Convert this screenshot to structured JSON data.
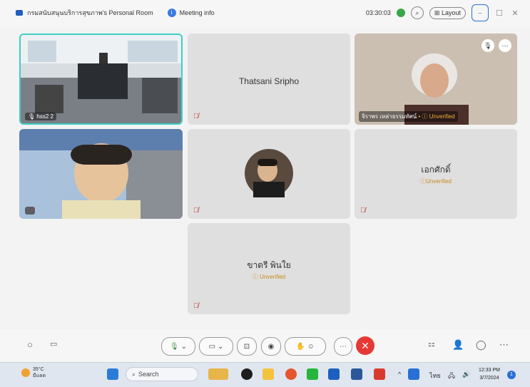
{
  "titlebar": {
    "room_name": "กรมสนับสนุนบริการสุขภาพ's Personal Room",
    "meeting_info_label": "Meeting info",
    "timer": "03:30:03",
    "layout_label": "Layout",
    "minimize_label": "–",
    "restore_label": "☐",
    "close_label": "✕"
  },
  "participants": {
    "p1": {
      "name": "hss2 2"
    },
    "p2": {
      "name": "Thatsani Sripho"
    },
    "p3": {
      "name": "จิราพร เหล่าธรรมทัศน์",
      "status": "Unverified"
    },
    "p4": {
      "name": ""
    },
    "p5": {
      "name": ""
    },
    "p6": {
      "name": "เอกศักดิ์",
      "status": "Unverified"
    },
    "p7": {
      "name": "ขาตรี พินใย",
      "status": "Unverified"
    }
  },
  "weather": {
    "temp": "35°C",
    "condition": "มีแดด"
  },
  "taskbar": {
    "search_placeholder": "Search",
    "language": "ไทย",
    "time": "12:33 PM",
    "date": "3/7/2024",
    "notification_count": "1"
  },
  "colors": {
    "active_border": "#3ccfc5",
    "end_call": "#e53935",
    "unverified": "#c88a1a",
    "accent": "#2a70d6"
  }
}
